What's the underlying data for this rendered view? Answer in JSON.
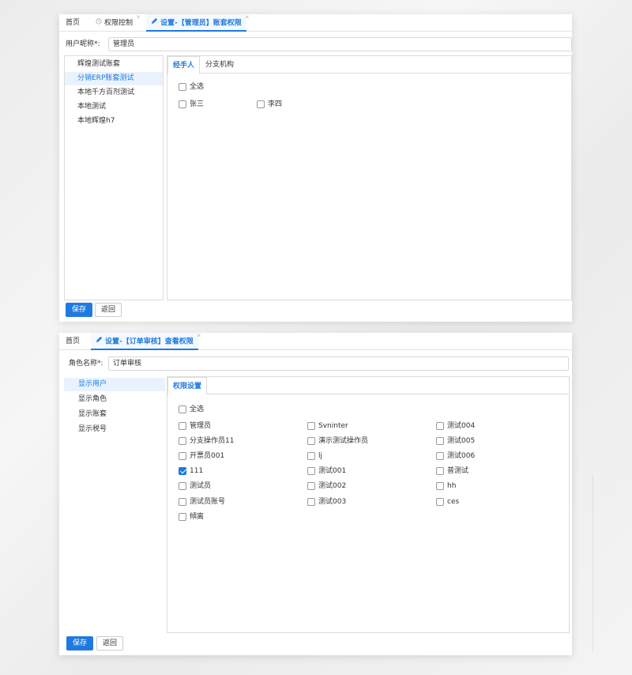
{
  "panel1": {
    "tabs": [
      {
        "label": "首页",
        "closable": false,
        "icon": null
      },
      {
        "label": "权限控制",
        "closable": true,
        "icon": "clock-icon"
      },
      {
        "label": "设置-【管理员】账套权限",
        "closable": true,
        "icon": "pencil-icon",
        "active": true
      }
    ],
    "field_label": "用户昵称*:",
    "field_value": "管理员",
    "left_items": [
      "辉煌测试账套",
      "分销ERP账套测试",
      "本地千方百剂测试",
      "本地测试",
      "本地辉煌h7"
    ],
    "selected_left_index": 1,
    "right_tabs": [
      "经手人",
      "分支机构"
    ],
    "select_all": "全选",
    "checkboxes": [
      {
        "label": "张三",
        "checked": false
      },
      {
        "label": "李四",
        "checked": false
      }
    ],
    "save": "保存",
    "back": "返回"
  },
  "panel2": {
    "tabs": [
      {
        "label": "首页",
        "closable": false,
        "icon": null
      },
      {
        "label": "设置-【订单审核】查看权限",
        "closable": true,
        "icon": "pencil-icon",
        "active": true
      }
    ],
    "field_label": "角色名称*:",
    "field_value": "订单审核",
    "left_items": [
      "显示用户",
      "显示角色",
      "显示账套",
      "显示税号"
    ],
    "selected_left_index": 0,
    "right_tabs": [
      "权限设置"
    ],
    "select_all": "全选",
    "checkbox_columns": [
      [
        {
          "label": "管理员",
          "checked": false
        },
        {
          "label": "分支操作员11",
          "checked": false
        },
        {
          "label": "开票员001",
          "checked": false
        },
        {
          "label": "111",
          "checked": true
        },
        {
          "label": "测试员",
          "checked": false
        },
        {
          "label": "测试员账号",
          "checked": false
        },
        {
          "label": "傾离",
          "checked": false
        }
      ],
      [
        {
          "label": "Svninter",
          "checked": false
        },
        {
          "label": "演示测试操作员",
          "checked": false
        },
        {
          "label": "lj",
          "checked": false
        },
        {
          "label": "测试001",
          "checked": false
        },
        {
          "label": "测试002",
          "checked": false
        },
        {
          "label": "测试003",
          "checked": false
        }
      ],
      [
        {
          "label": "测试004",
          "checked": false
        },
        {
          "label": "测试005",
          "checked": false
        },
        {
          "label": "测试006",
          "checked": false
        },
        {
          "label": "普测试",
          "checked": false
        },
        {
          "label": "hh",
          "checked": false
        },
        {
          "label": "ces",
          "checked": false
        }
      ]
    ],
    "save": "保存",
    "back": "返回"
  },
  "colors": {
    "accent": "#1f7ae0",
    "selected_bg": "#e9f2fd"
  }
}
